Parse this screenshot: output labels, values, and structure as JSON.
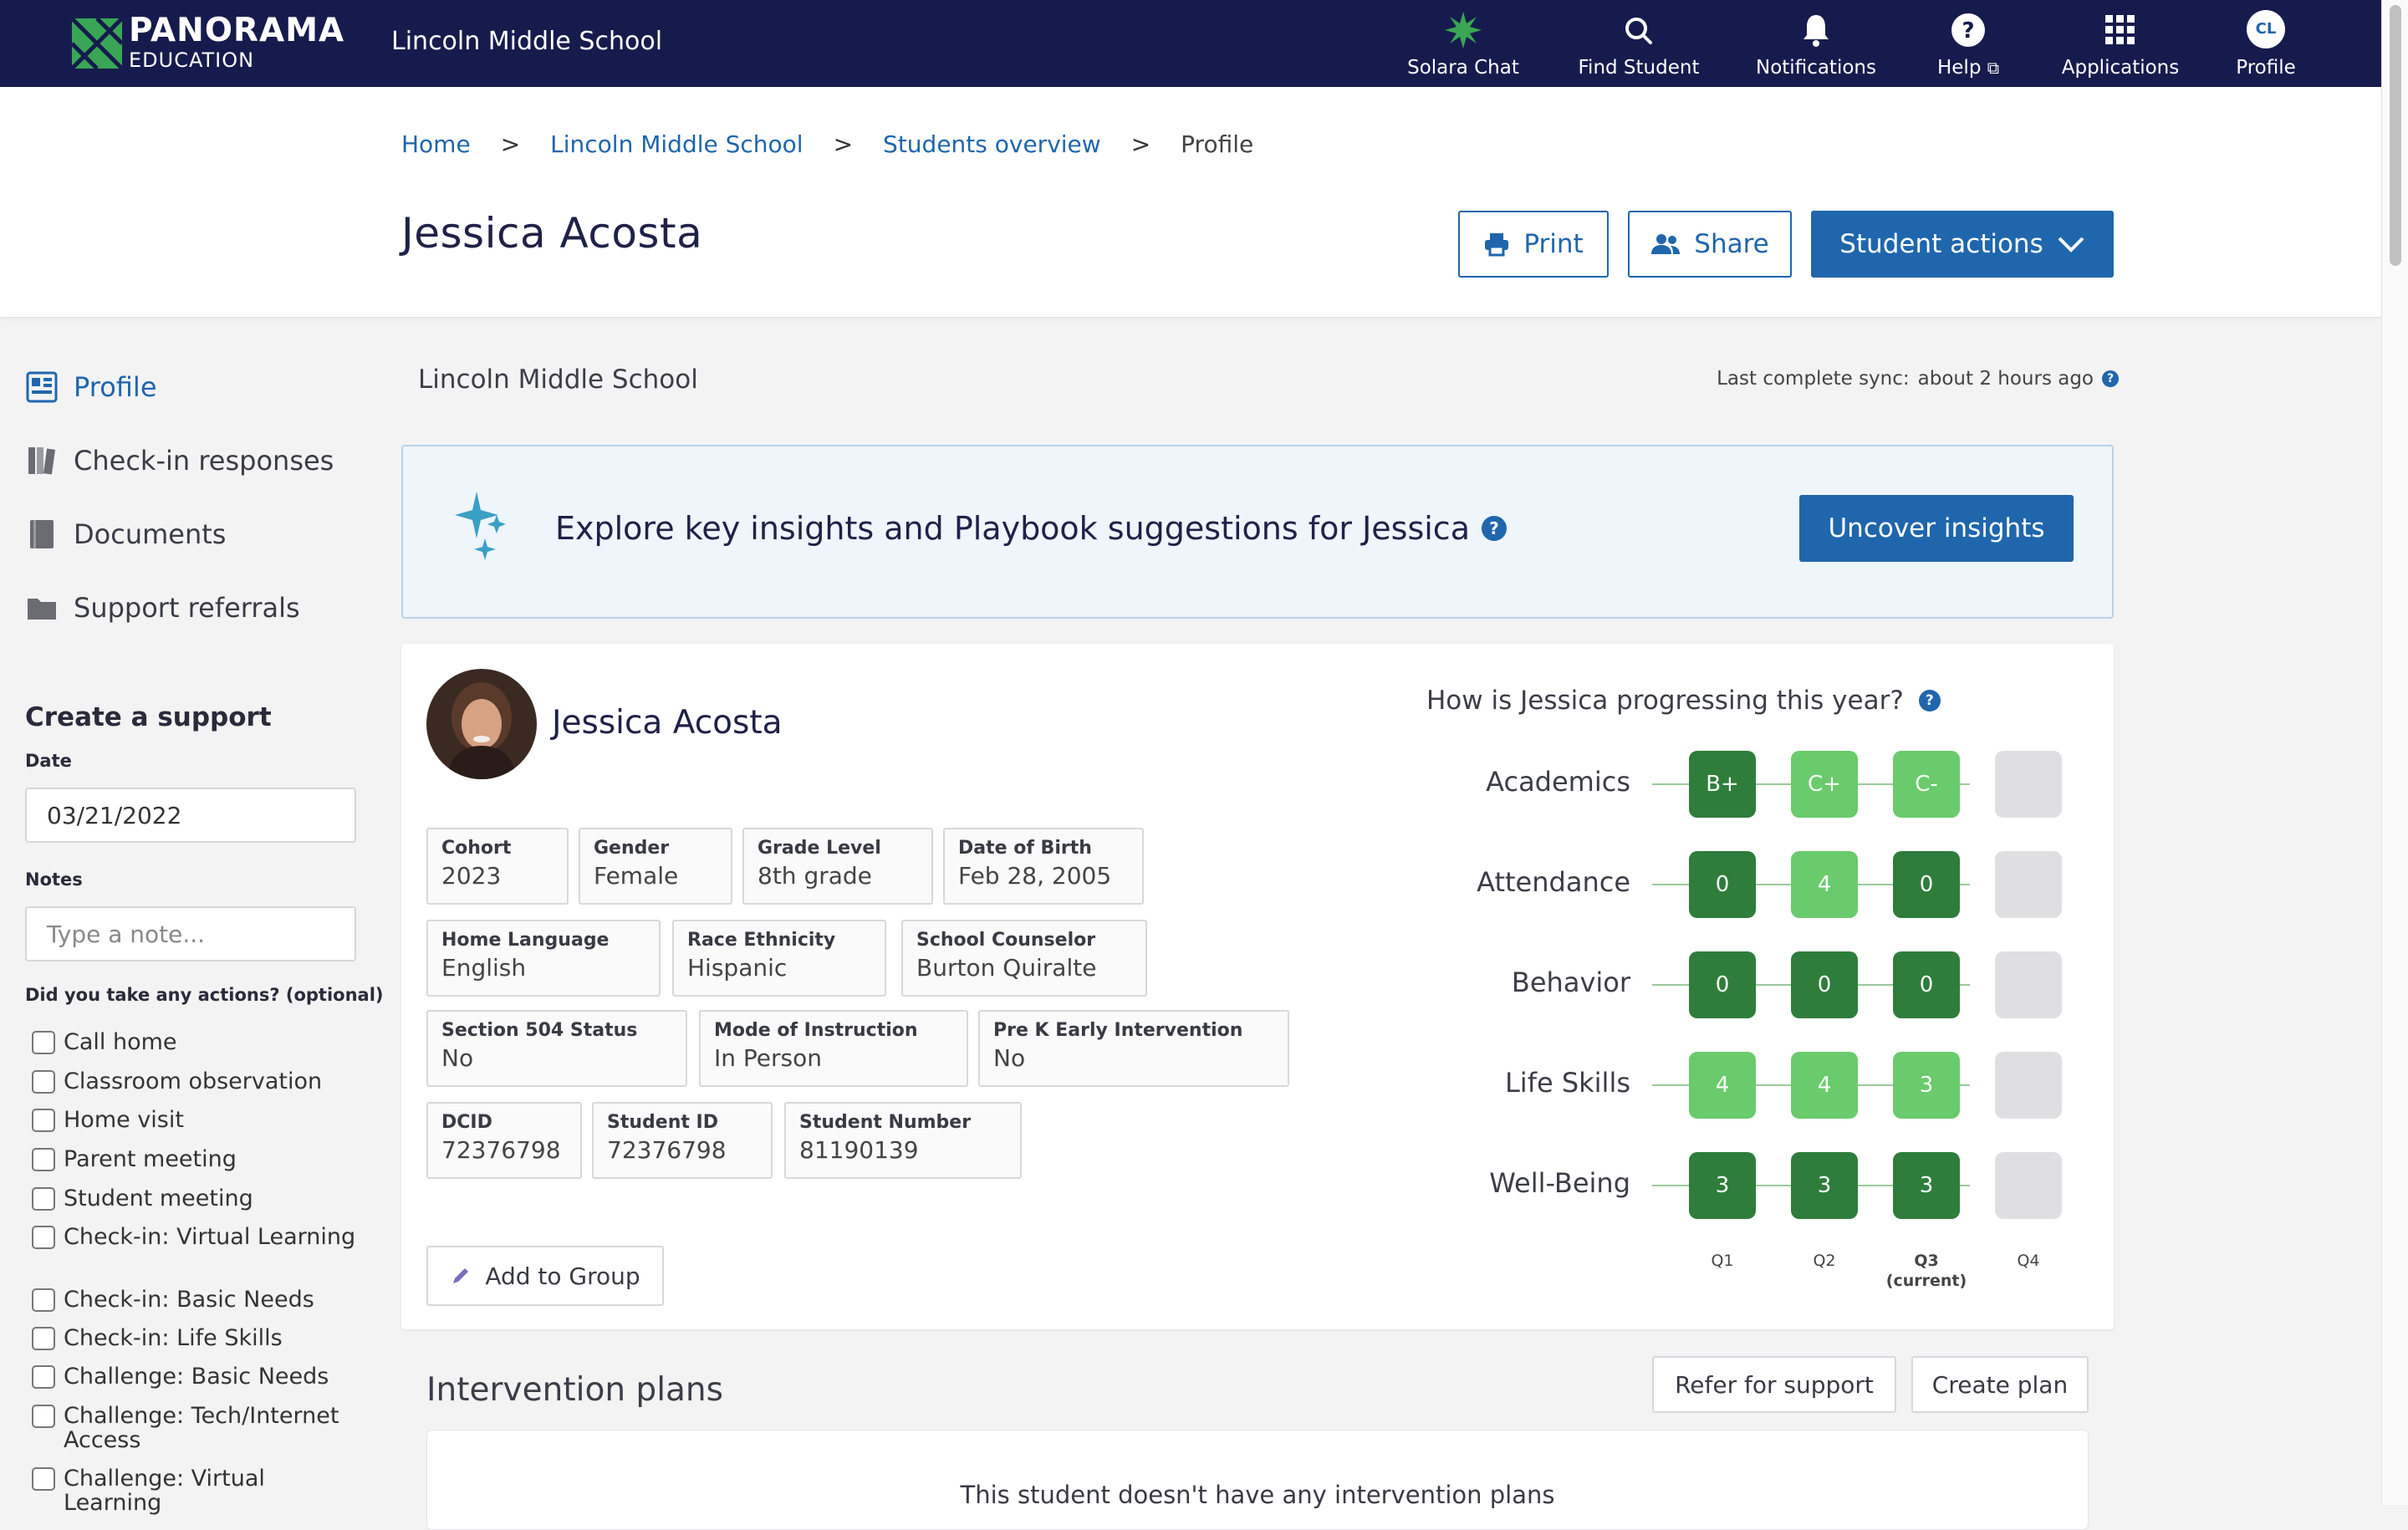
{
  "colors": {
    "nav_bg": "#161b4d",
    "primary": "#1f66ad",
    "grade_dark": "#2e7d3b",
    "grade_light": "#69cb6c",
    "grade_empty": "#dfdfe1",
    "insights_bg": "#eef5fb"
  },
  "brand": {
    "name": "PANORAMA",
    "sub": "EDUCATION",
    "school": "Lincoln Middle School"
  },
  "nav": {
    "solara": {
      "label": "Solara Chat",
      "icon": "star-burst-icon"
    },
    "find": {
      "label": "Find Student",
      "icon": "search-icon"
    },
    "notifications": {
      "label": "Notifications",
      "icon": "bell-icon"
    },
    "help": {
      "label": "Help",
      "icon": "help-circle-icon"
    },
    "applications": {
      "label": "Applications",
      "icon": "grid-icon"
    },
    "profile": {
      "label": "Profile",
      "initials": "CL"
    }
  },
  "breadcrumb": {
    "home": "Home",
    "school": "Lincoln Middle School",
    "overview": "Students overview",
    "current": "Profile",
    "sep": ">"
  },
  "page": {
    "title": "Jessica Acosta"
  },
  "header_buttons": {
    "print": "Print",
    "share": "Share",
    "actions": "Student actions"
  },
  "sidebar": {
    "items": [
      {
        "label": "Profile",
        "icon": "profile-icon",
        "active": true
      },
      {
        "label": "Check-in responses",
        "icon": "book-icon"
      },
      {
        "label": "Documents",
        "icon": "document-icon"
      },
      {
        "label": "Support referrals",
        "icon": "folder-icon"
      }
    ],
    "create": {
      "title": "Create a support",
      "date_label": "Date",
      "date_value": "03/21/2022",
      "notes_label": "Notes",
      "notes_placeholder": "Type a note...",
      "actions_label": "Did you take any actions? (optional)",
      "checkboxes": [
        "Call home",
        "Classroom observation",
        "Home visit",
        "Parent meeting",
        "Student meeting",
        "Check-in: Virtual Learning",
        "Check-in: Basic Needs",
        "Check-in: Life Skills",
        "Challenge: Basic Needs",
        "Challenge: Tech/Internet Access",
        "Challenge: Virtual Learning"
      ]
    }
  },
  "main": {
    "school": "Lincoln Middle School",
    "sync_label": "Last complete sync:",
    "sync_value": "about 2 hours ago",
    "insights_text": "Explore key insights and Playbook suggestions for Jessica",
    "insights_button": "Uncover insights"
  },
  "profile": {
    "name": "Jessica Acosta",
    "fields": [
      {
        "label": "Cohort",
        "value": "2023"
      },
      {
        "label": "Gender",
        "value": "Female"
      },
      {
        "label": "Grade Level",
        "value": "8th grade"
      },
      {
        "label": "Date of Birth",
        "value": "Feb 28, 2005"
      },
      {
        "label": "Home Language",
        "value": "English"
      },
      {
        "label": "Race Ethnicity",
        "value": "Hispanic"
      },
      {
        "label": "School Counselor",
        "value": "Burton Quiralte"
      },
      {
        "label": "Section 504 Status",
        "value": "No"
      },
      {
        "label": "Mode of Instruction",
        "value": "In Person"
      },
      {
        "label": "Pre K Early Intervention",
        "value": "No"
      },
      {
        "label": "DCID",
        "value": "72376798"
      },
      {
        "label": "Student ID",
        "value": "72376798"
      },
      {
        "label": "Student Number",
        "value": "81190139"
      }
    ],
    "add_group": "Add to Group"
  },
  "progress": {
    "title": "How is Jessica progressing this year?",
    "quarters": [
      {
        "label": "Q1",
        "sub": ""
      },
      {
        "label": "Q2",
        "sub": ""
      },
      {
        "label": "Q3",
        "sub": "(current)"
      },
      {
        "label": "Q4",
        "sub": ""
      }
    ],
    "rows": [
      {
        "label": "Academics",
        "cells": [
          {
            "v": "B+",
            "tone": "dark"
          },
          {
            "v": "C+",
            "tone": "light"
          },
          {
            "v": "C-",
            "tone": "light"
          },
          {
            "v": "",
            "tone": "empty"
          }
        ]
      },
      {
        "label": "Attendance",
        "cells": [
          {
            "v": "0",
            "tone": "dark"
          },
          {
            "v": "4",
            "tone": "light"
          },
          {
            "v": "0",
            "tone": "dark"
          },
          {
            "v": "",
            "tone": "empty"
          }
        ]
      },
      {
        "label": "Behavior",
        "cells": [
          {
            "v": "0",
            "tone": "dark"
          },
          {
            "v": "0",
            "tone": "dark"
          },
          {
            "v": "0",
            "tone": "dark"
          },
          {
            "v": "",
            "tone": "empty"
          }
        ]
      },
      {
        "label": "Life Skills",
        "cells": [
          {
            "v": "4",
            "tone": "light"
          },
          {
            "v": "4",
            "tone": "light"
          },
          {
            "v": "3",
            "tone": "light"
          },
          {
            "v": "",
            "tone": "empty"
          }
        ]
      },
      {
        "label": "Well-Being",
        "cells": [
          {
            "v": "3",
            "tone": "dark"
          },
          {
            "v": "3",
            "tone": "dark"
          },
          {
            "v": "3",
            "tone": "dark"
          },
          {
            "v": "",
            "tone": "empty"
          }
        ]
      }
    ]
  },
  "interventions": {
    "title": "Intervention plans",
    "refer": "Refer for support",
    "create": "Create plan",
    "empty": "This student doesn't have any intervention plans"
  }
}
